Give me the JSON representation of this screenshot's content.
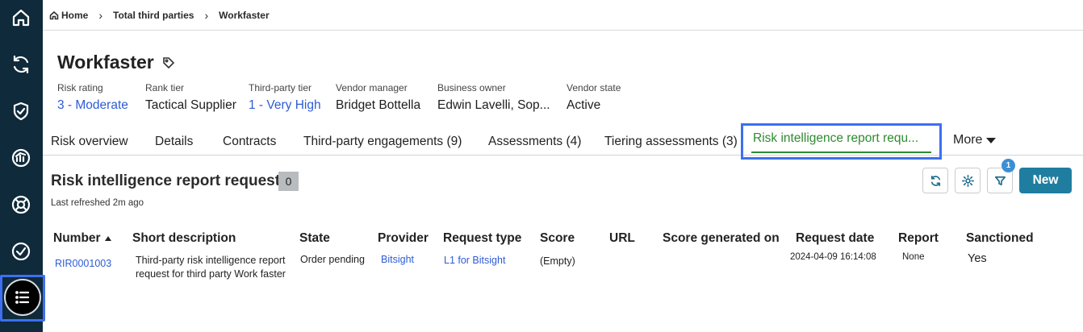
{
  "breadcrumb": {
    "items": [
      "Home",
      "Total third parties",
      "Workfaster"
    ]
  },
  "record": {
    "title": "Workfaster",
    "fields": [
      {
        "label": "Risk rating",
        "value": "3 - Moderate",
        "link": true
      },
      {
        "label": "Rank tier",
        "value": "Tactical Supplier",
        "link": false
      },
      {
        "label": "Third-party tier",
        "value": "1 - Very High",
        "link": true
      },
      {
        "label": "Vendor manager",
        "value": "Bridget Bottella",
        "link": false
      },
      {
        "label": "Business owner",
        "value": "Edwin Lavelli, Sop...",
        "link": false
      },
      {
        "label": "Vendor state",
        "value": "Active",
        "link": false
      }
    ]
  },
  "tabs": {
    "items": [
      "Risk overview",
      "Details",
      "Contracts",
      "Third-party engagements (9)",
      "Assessments (4)",
      "Tiering assessments (3)"
    ],
    "active": "Risk intelligence report requ...",
    "more": "More"
  },
  "section": {
    "title": "Risk intelligence report requests",
    "count": "0",
    "refreshed": "Last refreshed 2m ago",
    "filter_count": "1",
    "new_label": "New"
  },
  "table": {
    "columns": [
      "Number",
      "Short description",
      "State",
      "Provider",
      "Request type",
      "Score",
      "URL",
      "Score generated on",
      "Request date",
      "Report",
      "Sanctioned"
    ],
    "rows": [
      {
        "number": "RIR0001003",
        "short_description_line1": "Third-party risk intelligence report",
        "short_description_line2": "request for third party Work faster",
        "state": "Order pending",
        "provider": "Bitsight",
        "request_type": "L1 for Bitsight",
        "score": "(Empty)",
        "url": "",
        "score_generated_on": "",
        "request_date": "2024-04-09 16:14:08",
        "report": "None",
        "sanctioned": "Yes"
      }
    ]
  },
  "colors": {
    "sidebar": "#0f2a3a",
    "accent_link": "#2e5cd6",
    "active_tab": "#2f8a2f",
    "primary_button": "#1f7ea0",
    "highlight_outline": "#3d6ff0"
  }
}
